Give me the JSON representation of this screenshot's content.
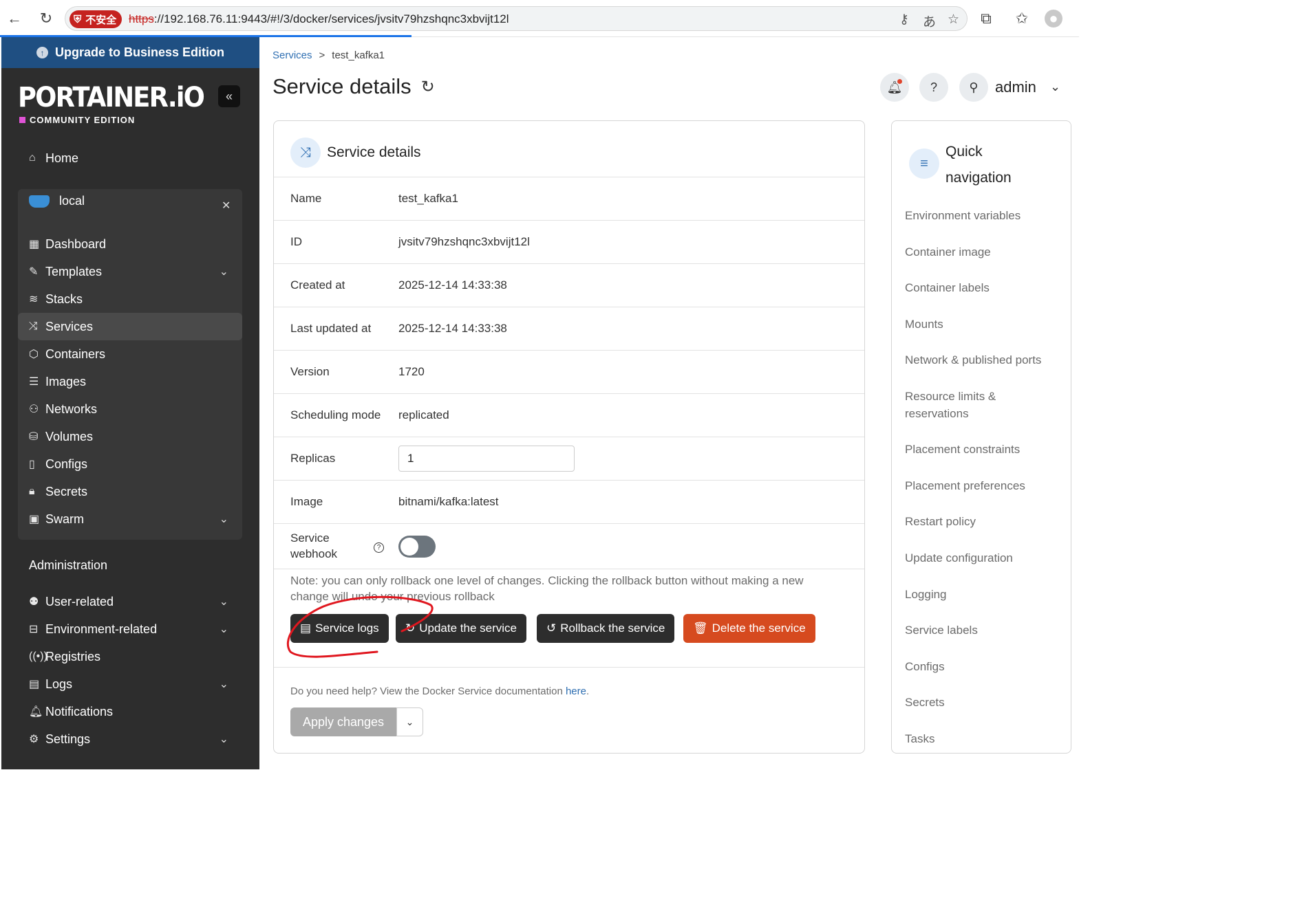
{
  "browser": {
    "security_label": "不安全",
    "url_scheme": "https",
    "url_rest": "://192.168.76.11:9443/#!/3/docker/services/jvsitv79hzshqnc3xbvijt12l"
  },
  "sidebar": {
    "upgrade_label": "Upgrade to Business Edition",
    "logo_text": "PORTAINER.iO",
    "edition": "COMMUNITY EDITION",
    "home": "Home",
    "environment": "local",
    "env_items": [
      {
        "label": "Dashboard",
        "icon": "dashboard-icon"
      },
      {
        "label": "Templates",
        "icon": "edit-icon"
      },
      {
        "label": "Stacks",
        "icon": "layers-icon"
      },
      {
        "label": "Services",
        "icon": "shuffle-icon"
      },
      {
        "label": "Containers",
        "icon": "box-icon"
      },
      {
        "label": "Images",
        "icon": "list-icon"
      },
      {
        "label": "Networks",
        "icon": "network-icon"
      },
      {
        "label": "Volumes",
        "icon": "database-icon"
      },
      {
        "label": "Configs",
        "icon": "clipboard-icon"
      },
      {
        "label": "Secrets",
        "icon": "lock-icon"
      },
      {
        "label": "Swarm",
        "icon": "trello-icon"
      }
    ],
    "admin_title": "Administration",
    "admin_items": [
      {
        "label": "User-related"
      },
      {
        "label": "Environment-related"
      },
      {
        "label": "Registries"
      },
      {
        "label": "Logs"
      },
      {
        "label": "Notifications"
      },
      {
        "label": "Settings"
      }
    ]
  },
  "header": {
    "breadcrumb_link": "Services",
    "breadcrumb_sep": ">",
    "breadcrumb_current": "test_kafka1",
    "title": "Service details",
    "user": "admin"
  },
  "details": {
    "card_title": "Service details",
    "rows": [
      {
        "label": "Name",
        "value": "test_kafka1"
      },
      {
        "label": "ID",
        "value": "jvsitv79hzshqnc3xbvijt12l"
      },
      {
        "label": "Created at",
        "value": "2025-12-14 14:33:38"
      },
      {
        "label": "Last updated at",
        "value": "2025-12-14 14:33:38"
      },
      {
        "label": "Version",
        "value": "1720"
      },
      {
        "label": "Scheduling mode",
        "value": "replicated"
      }
    ],
    "replicas_label": "Replicas",
    "replicas_value": "1",
    "image_label": "Image",
    "image_value": "bitnami/kafka:latest",
    "webhook_label_1": "Service",
    "webhook_label_2": "webhook",
    "webhook_enabled": false,
    "note": "Note: you can only rollback one level of changes. Clicking the rollback button without making a new change will undo your previous rollback",
    "buttons": {
      "logs": "Service logs",
      "update": "Update the service",
      "rollback": "Rollback the service",
      "delete": "Delete the service"
    },
    "help_text": "Do you need help? View the Docker Service documentation ",
    "help_link": "here",
    "help_end": ".",
    "apply": "Apply changes"
  },
  "quick_nav": {
    "title": "Quick navigation",
    "items": [
      "Environment variables",
      "Container image",
      "Container labels",
      "Mounts",
      "Network & published ports",
      "Resource limits & reservations",
      "Placement constraints",
      "Placement preferences",
      "Restart policy",
      "Update configuration",
      "Logging",
      "Service labels",
      "Configs",
      "Secrets",
      "Tasks"
    ]
  },
  "colors": {
    "sidebar_bg": "#2d2d2d",
    "upgrade_bg": "#1f4f82",
    "danger": "#d64a1f",
    "link": "#2f6fb2",
    "annotation": "#e0171f"
  }
}
